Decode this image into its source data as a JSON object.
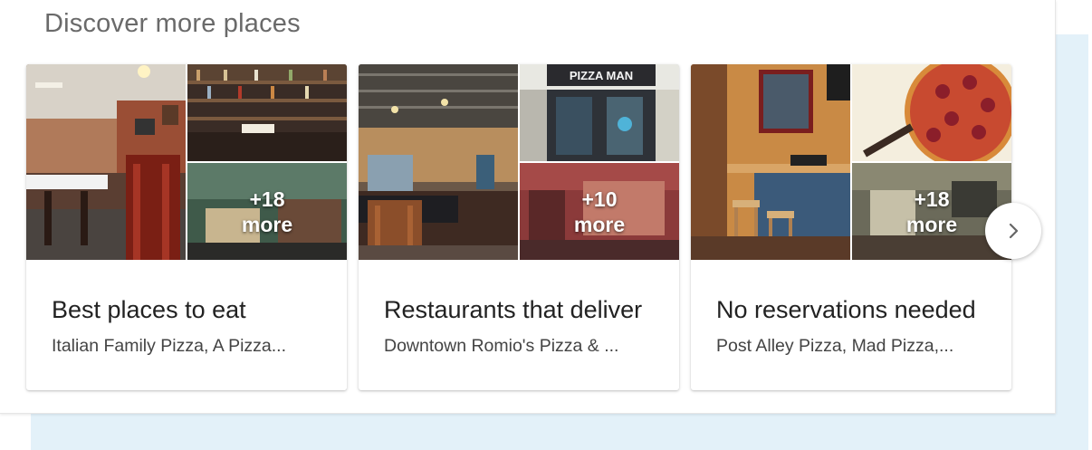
{
  "section": {
    "title": "Discover more places"
  },
  "cards": [
    {
      "title": "Best places to eat",
      "subtitle": "Italian Family Pizza, A Pizza...",
      "more_count": "+18",
      "more_label": "more"
    },
    {
      "title": "Restaurants that deliver",
      "subtitle": "Downtown Romio's Pizza & ...",
      "more_count": "+10",
      "more_label": "more"
    },
    {
      "title": "No reservations needed",
      "subtitle": "Post Alley Pizza, Mad Pizza,...",
      "more_count": "+18",
      "more_label": "more"
    }
  ],
  "storefront_sign": "PIZZA MAN",
  "icons": {
    "next": "chevron-right-icon"
  },
  "colors": {
    "accent_background": "#e3f1f9",
    "title_text": "#6a6a6a"
  }
}
